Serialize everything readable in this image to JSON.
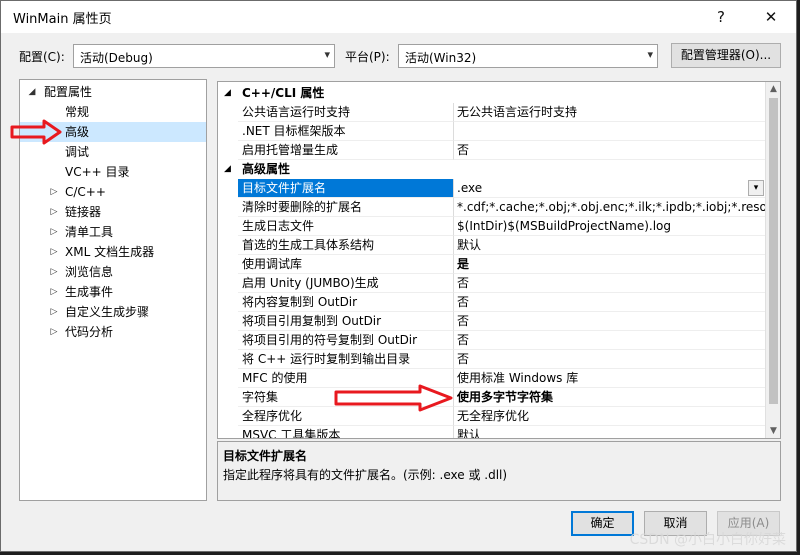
{
  "window": {
    "title": "WinMain 属性页",
    "help_glyph": "?",
    "close_glyph": "✕"
  },
  "config_row": {
    "config_label": "配置(C):",
    "config_value": "活动(Debug)",
    "platform_label": "平台(P):",
    "platform_value": "活动(Win32)",
    "manager_button": "配置管理器(O)..."
  },
  "tree": {
    "root": "配置属性",
    "items": [
      {
        "label": "常规"
      },
      {
        "label": "高级"
      },
      {
        "label": "调试"
      },
      {
        "label": "VC++ 目录"
      },
      {
        "label": "C/C++"
      },
      {
        "label": "链接器"
      },
      {
        "label": "清单工具"
      },
      {
        "label": "XML 文档生成器"
      },
      {
        "label": "浏览信息"
      },
      {
        "label": "生成事件"
      },
      {
        "label": "自定义生成步骤"
      },
      {
        "label": "代码分析"
      }
    ]
  },
  "grid": {
    "cat1": "C++/CLI 属性",
    "cat1_rows": [
      {
        "name": "公共语言运行时支持",
        "value": "无公共语言运行时支持"
      },
      {
        "name": ".NET 目标框架版本",
        "value": ""
      },
      {
        "name": "启用托管增量生成",
        "value": "否"
      }
    ],
    "cat2": "高级属性",
    "cat2_rows": [
      {
        "name": "目标文件扩展名",
        "value": ".exe"
      },
      {
        "name": "清除时要删除的扩展名",
        "value": "*.cdf;*.cache;*.obj;*.obj.enc;*.ilk;*.ipdb;*.iobj;*.resources"
      },
      {
        "name": "生成日志文件",
        "value": "$(IntDir)$(MSBuildProjectName).log"
      },
      {
        "name": "首选的生成工具体系结构",
        "value": "默认"
      },
      {
        "name": "使用调试库",
        "value": "是"
      },
      {
        "name": "启用 Unity (JUMBO)生成",
        "value": "否"
      },
      {
        "name": "将内容复制到 OutDir",
        "value": "否"
      },
      {
        "name": "将项目引用复制到 OutDir",
        "value": "否"
      },
      {
        "name": "将项目引用的符号复制到 OutDir",
        "value": "否"
      },
      {
        "name": "将 C++ 运行时复制到输出目录",
        "value": "否"
      },
      {
        "name": "MFC 的使用",
        "value": "使用标准 Windows 库"
      },
      {
        "name": "字符集",
        "value": "使用多字节字符集"
      },
      {
        "name": "全程序优化",
        "value": "无全程序优化"
      },
      {
        "name": "MSVC 工具集版本",
        "value": "默认"
      }
    ]
  },
  "description": {
    "title": "目标文件扩展名",
    "text": "指定此程序将具有的文件扩展名。(示例: .exe 或 .dll)"
  },
  "buttons": {
    "ok": "确定",
    "cancel": "取消",
    "apply": "应用(A)"
  },
  "watermark": "CSDN @小白小白你好菜",
  "colors": {
    "selection": "#0078d7",
    "annotation_arrow": "#e8191f"
  }
}
